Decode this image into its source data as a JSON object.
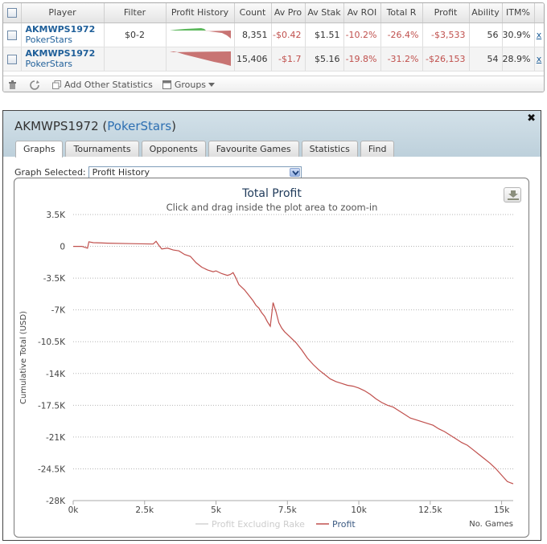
{
  "table": {
    "headers": [
      "",
      "Player",
      "Filter",
      "Profit History",
      "Count",
      "Av Pro",
      "Av Stak",
      "Av ROI",
      "Total R",
      "Profit",
      "Ability",
      "ITM%",
      ""
    ],
    "rows": [
      {
        "player": "AKMWPS1972",
        "site": "PokerStars",
        "filter": "$0-2",
        "count": "8,351",
        "av_profit": "-$0.42",
        "av_stake": "$1.51",
        "av_roi": "-10.2%",
        "total_roi": "-26.4%",
        "profit": "-$3,533",
        "ability": "56",
        "itm": "30.9%",
        "remove": "x"
      },
      {
        "player": "AKMWPS1972",
        "site": "PokerStars",
        "filter": "",
        "count": "15,406",
        "av_profit": "-$1.7",
        "av_stake": "$5.16",
        "av_roi": "-19.8%",
        "total_roi": "-31.2%",
        "profit": "-$26,153",
        "ability": "54",
        "itm": "28.9%",
        "remove": "x"
      }
    ]
  },
  "toolbar": {
    "add_stats": "Add Other Statistics",
    "groups": "Groups"
  },
  "window": {
    "player": "AKMWPS1972",
    "site": "PokerStars",
    "tabs": [
      {
        "label": "Graphs",
        "active": true
      },
      {
        "label": "Tournaments"
      },
      {
        "label": "Opponents"
      },
      {
        "label": "Favourite Games"
      },
      {
        "label": "Statistics"
      },
      {
        "label": "Find"
      }
    ],
    "graph_label": "Graph Selected:",
    "graph_value": "Profit History"
  },
  "chart_data": {
    "type": "line",
    "title": "Total Profit",
    "subtitle": "Click and drag inside the plot area to zoom-in",
    "xlabel": "No. Games",
    "ylabel": "Cumulative Total (USD)",
    "xlim": [
      0,
      15406
    ],
    "ylim": [
      -28000,
      3500
    ],
    "xticks": [
      0,
      2500,
      5000,
      7500,
      10000,
      12500,
      15000
    ],
    "xtick_labels": [
      "0k",
      "2.5k",
      "5k",
      "7.5k",
      "10k",
      "12.5k",
      "15k"
    ],
    "yticks": [
      3500,
      0,
      -3500,
      -7000,
      -10500,
      -14000,
      -17500,
      -21000,
      -24500,
      -28000
    ],
    "ytick_labels": [
      "3.5K",
      "0",
      "-3.5K",
      "-7K",
      "-10.5K",
      "-14K",
      "-17.5K",
      "-21K",
      "-24.5K",
      "-28K"
    ],
    "grid": "horizontal-dotted",
    "legend": "bottom-center",
    "series": [
      {
        "name": "Profit Excluding Rake",
        "color": "#d3d3d3",
        "visible": false,
        "x": [],
        "y": []
      },
      {
        "name": "Profit",
        "color": "#c0504d",
        "visible": true,
        "x": [
          0,
          300,
          500,
          550,
          700,
          1200,
          2000,
          2800,
          2900,
          3000,
          3100,
          3300,
          3500,
          3700,
          3900,
          4100,
          4300,
          4500,
          4700,
          4900,
          5000,
          5200,
          5400,
          5500,
          5600,
          5700,
          5800,
          6000,
          6200,
          6300,
          6400,
          6500,
          6600,
          6700,
          6800,
          6900,
          7000,
          7100,
          7200,
          7300,
          7400,
          7600,
          7800,
          8000,
          8200,
          8400,
          8600,
          8800,
          9000,
          9200,
          9400,
          9600,
          9800,
          10000,
          10200,
          10400,
          10600,
          10800,
          11000,
          11200,
          11400,
          11600,
          11800,
          12000,
          12200,
          12400,
          12600,
          12800,
          13000,
          13200,
          13400,
          13600,
          13800,
          14000,
          14200,
          14400,
          14600,
          14800,
          15000,
          15200,
          15406
        ],
        "y": [
          0,
          0,
          -200,
          500,
          400,
          350,
          300,
          250,
          550,
          100,
          -300,
          -200,
          -400,
          -500,
          -900,
          -1100,
          -1800,
          -2300,
          -2600,
          -2800,
          -2700,
          -3000,
          -3200,
          -3100,
          -2900,
          -3500,
          -4200,
          -4800,
          -5600,
          -6000,
          -6500,
          -6800,
          -7300,
          -7700,
          -8300,
          -8800,
          -6200,
          -7200,
          -8400,
          -9000,
          -9400,
          -10000,
          -10600,
          -11400,
          -12300,
          -13000,
          -13600,
          -14100,
          -14600,
          -14900,
          -15100,
          -15300,
          -15400,
          -15600,
          -15900,
          -16300,
          -16800,
          -17200,
          -17500,
          -17700,
          -18100,
          -18500,
          -18900,
          -19100,
          -19300,
          -19500,
          -19700,
          -20100,
          -20400,
          -20800,
          -21200,
          -21600,
          -21900,
          -22400,
          -22900,
          -23400,
          -23900,
          -24500,
          -25200,
          -25900,
          -26153
        ]
      }
    ]
  }
}
